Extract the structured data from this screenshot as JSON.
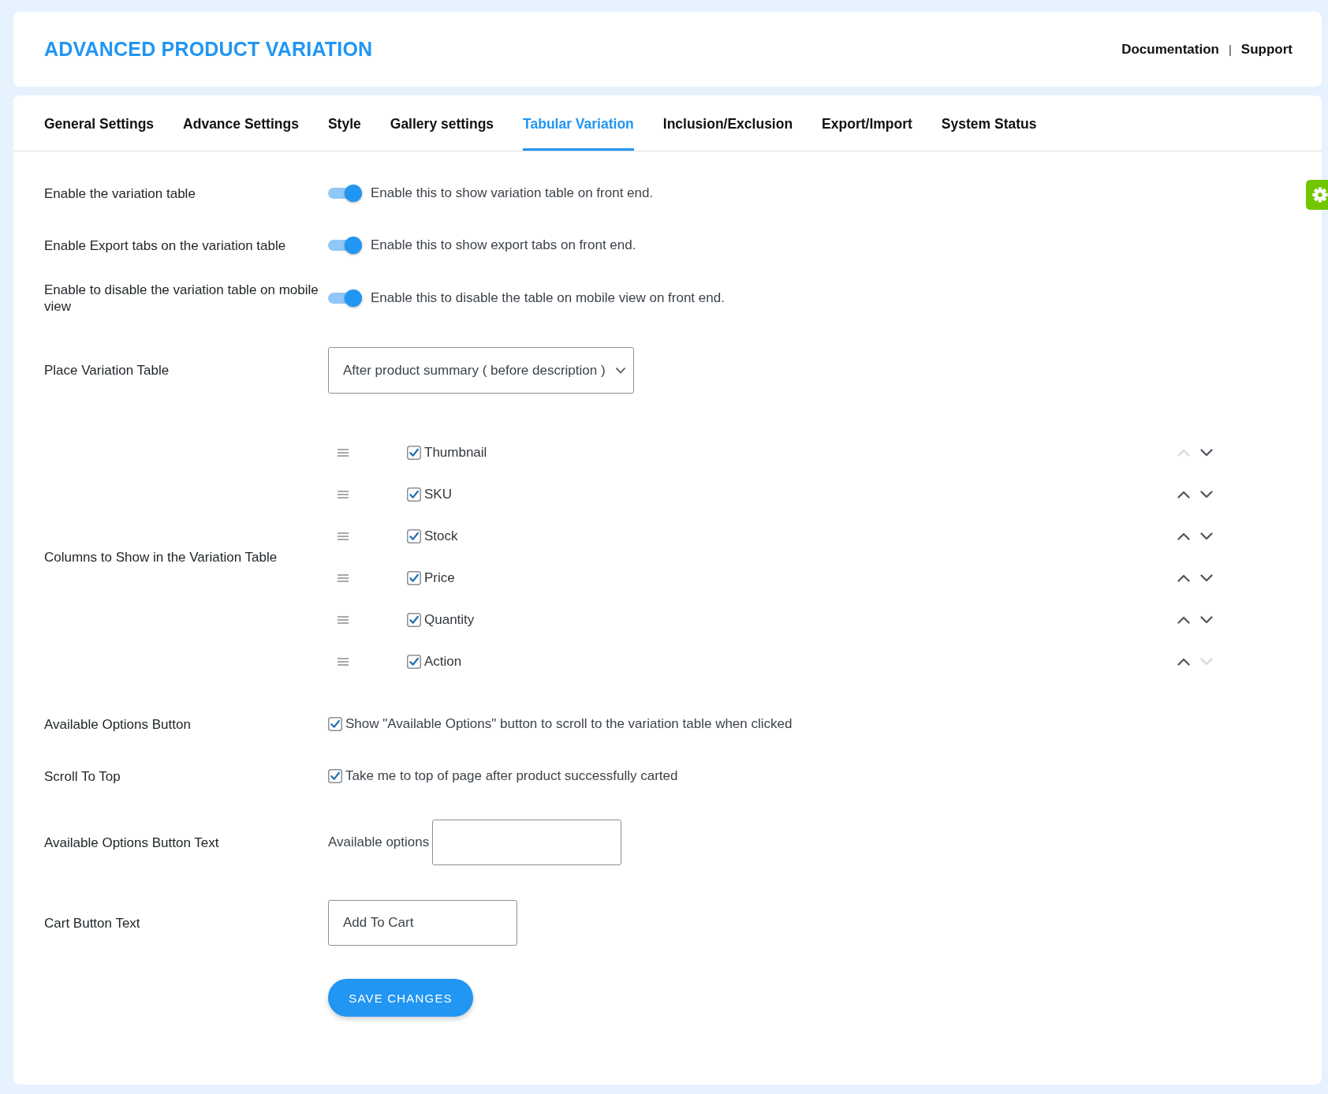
{
  "header": {
    "title": "ADVANCED PRODUCT VARIATION",
    "links": [
      "Documentation",
      "Support"
    ],
    "separator": "|"
  },
  "tabs": [
    {
      "label": "General Settings",
      "selected": false
    },
    {
      "label": "Advance Settings",
      "selected": false
    },
    {
      "label": "Style",
      "selected": false
    },
    {
      "label": "Gallery settings",
      "selected": false
    },
    {
      "label": "Tabular Variation",
      "selected": true
    },
    {
      "label": "Inclusion/Exclusion",
      "selected": false
    },
    {
      "label": "Export/Import",
      "selected": false
    },
    {
      "label": "System Status",
      "selected": false
    }
  ],
  "settings": [
    {
      "kind": "toggle",
      "label": "Enable the variation table",
      "on": true,
      "description": "Enable this to show variation table on front end."
    },
    {
      "kind": "toggle",
      "label": "Enable Export tabs on the variation table",
      "on": true,
      "description": "Enable this to show export tabs on front end."
    },
    {
      "kind": "toggle",
      "label": "Enable to disable the variation table on mobile view",
      "on": true,
      "description": "Enable this to disable the table on mobile view on front end."
    },
    {
      "kind": "select",
      "label": "Place Variation Table",
      "value": "After product summary ( before description )"
    },
    {
      "kind": "column_list",
      "label": "Columns to Show in the Variation Table",
      "columns": [
        {
          "name": "Thumbnail",
          "checked": true,
          "up_disabled": true,
          "down_disabled": false
        },
        {
          "name": "SKU",
          "checked": true,
          "up_disabled": false,
          "down_disabled": false
        },
        {
          "name": "Stock",
          "checked": true,
          "up_disabled": false,
          "down_disabled": false
        },
        {
          "name": "Price",
          "checked": true,
          "up_disabled": false,
          "down_disabled": false
        },
        {
          "name": "Quantity",
          "checked": true,
          "up_disabled": false,
          "down_disabled": false
        },
        {
          "name": "Action",
          "checked": true,
          "up_disabled": false,
          "down_disabled": true
        }
      ]
    },
    {
      "kind": "checkbox",
      "label": "Available Options Button",
      "checked": true,
      "description": "Show \"Available Options\" button to scroll to the variation table when clicked"
    },
    {
      "kind": "checkbox",
      "label": "Scroll To Top",
      "checked": true,
      "description": "Take me to top of page after product successfully carted"
    },
    {
      "kind": "prefixed_input",
      "label": "Available Options Button Text",
      "prefix": "Available options"
    },
    {
      "kind": "input",
      "label": "Cart Button Text",
      "value": "Add To Cart"
    }
  ],
  "save_button": {
    "label": "SAVE CHANGES"
  }
}
